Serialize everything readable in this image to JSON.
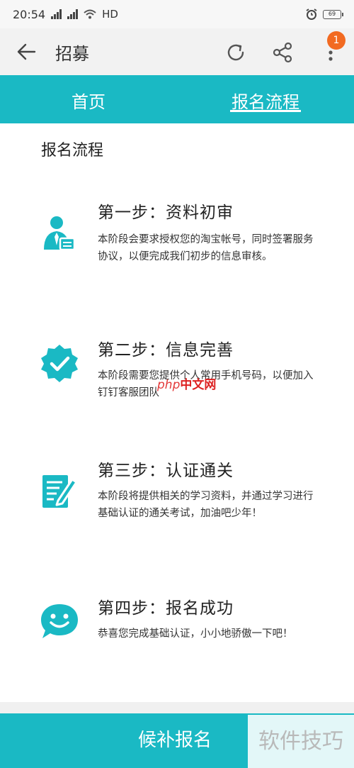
{
  "status_bar": {
    "time": "20:54",
    "network": "HD",
    "battery": "69"
  },
  "app_bar": {
    "title": "招募",
    "notification_count": "1"
  },
  "tabs": [
    {
      "label": "首页",
      "active": false
    },
    {
      "label": "报名流程",
      "active": true
    }
  ],
  "section_title": "报名流程",
  "steps": [
    {
      "title": "第一步：资料初审",
      "description": "本阶段会要求授权您的淘宝帐号，同时签署服务协议，以便完成我们初步的信息审核。",
      "icon": "user-card-icon"
    },
    {
      "title": "第二步：信息完善",
      "description": "本阶段需要您提供个人常用手机号码，以便加入钉钉客服团队",
      "icon": "verified-badge-icon"
    },
    {
      "title": "第三步：认证通关",
      "description": "本阶段将提供相关的学习资料，并通过学习进行基础认证的通关考试，加油吧少年！",
      "icon": "edit-document-icon"
    },
    {
      "title": "第四步：报名成功",
      "description": "恭喜您完成基础认证，小小地骄傲一下吧！",
      "icon": "smile-icon"
    }
  ],
  "bottom_button": "候补报名",
  "watermarks": {
    "corner": "软件技巧",
    "php_latin": "php",
    "php_cn": "中文网"
  },
  "colors": {
    "primary": "#1ab9c4",
    "badge": "#f26a21"
  }
}
